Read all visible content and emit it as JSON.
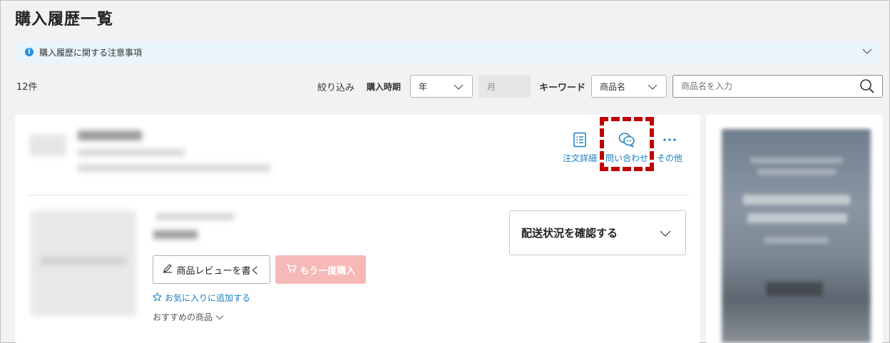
{
  "page": {
    "title": "購入履歴一覧"
  },
  "notice": {
    "text": "購入履歴に関する注意事項",
    "icon": "info-icon"
  },
  "toolbar": {
    "count": "12件",
    "filter_label": "絞り込み",
    "period_label": "購入時期",
    "year_value": "年",
    "month_value": "月",
    "keyword_label": "キーワード",
    "keyword_type_value": "商品名",
    "keyword_placeholder": "商品名を入力"
  },
  "order": {
    "actions": {
      "detail_label": "注文詳細",
      "inquiry_label": "問い合わせ",
      "more_label": "その他"
    },
    "delivery_label": "配送状況を確認する",
    "review_button_label": "商品レビューを書く",
    "rebuy_button_label": "もう一度購入",
    "favorite_link_label": "お気に入りに追加する",
    "recommend_link_label": "おすすめの商品"
  },
  "colors": {
    "accent_link": "#1a7fc0",
    "highlight_dashed": "#c00000",
    "rebuy_button": "#f7b8b8",
    "notice_bg": "#e9f4fb"
  }
}
